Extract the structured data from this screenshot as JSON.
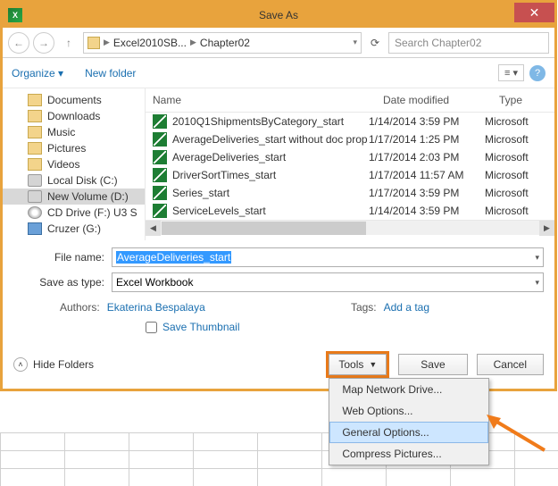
{
  "title": "Save As",
  "breadcrumb": {
    "seg1": "Excel2010SB...",
    "seg2": "Chapter02"
  },
  "search_placeholder": "Search Chapter02",
  "toolbar": {
    "organize": "Organize",
    "newfolder": "New folder"
  },
  "tree": [
    {
      "label": "Documents",
      "icon": "folder"
    },
    {
      "label": "Downloads",
      "icon": "folder"
    },
    {
      "label": "Music",
      "icon": "folder"
    },
    {
      "label": "Pictures",
      "icon": "folder"
    },
    {
      "label": "Videos",
      "icon": "folder"
    },
    {
      "label": "Local Disk (C:)",
      "icon": "disk"
    },
    {
      "label": "New Volume (D:)",
      "icon": "disk",
      "selected": true
    },
    {
      "label": "CD Drive (F:) U3 S",
      "icon": "cd"
    },
    {
      "label": "Cruzer (G:)",
      "icon": "usb"
    }
  ],
  "columns": {
    "name": "Name",
    "date": "Date modified",
    "type": "Type"
  },
  "files": [
    {
      "name": "2010Q1ShipmentsByCategory_start",
      "date": "1/14/2014 3:59 PM",
      "type": "Microsoft"
    },
    {
      "name": "AverageDeliveries_start without doc prop",
      "date": "1/17/2014 1:25 PM",
      "type": "Microsoft"
    },
    {
      "name": "AverageDeliveries_start",
      "date": "1/17/2014 2:03 PM",
      "type": "Microsoft"
    },
    {
      "name": "DriverSortTimes_start",
      "date": "1/17/2014 11:57 AM",
      "type": "Microsoft"
    },
    {
      "name": "Series_start",
      "date": "1/17/2014 3:59 PM",
      "type": "Microsoft"
    },
    {
      "name": "ServiceLevels_start",
      "date": "1/14/2014 3:59 PM",
      "type": "Microsoft"
    }
  ],
  "form": {
    "filename_label": "File name:",
    "filename_value": "AverageDeliveries_start",
    "saveas_label": "Save as type:",
    "saveas_value": "Excel Workbook",
    "authors_label": "Authors:",
    "authors_value": "Ekaterina Bespalaya",
    "tags_label": "Tags:",
    "tags_value": "Add a tag",
    "thumbnail": "Save Thumbnail"
  },
  "footer": {
    "hide": "Hide Folders",
    "tools": "Tools",
    "save": "Save",
    "cancel": "Cancel"
  },
  "menu": {
    "i1": "Map Network Drive...",
    "i2": "Web Options...",
    "i3": "General Options...",
    "i4": "Compress Pictures..."
  }
}
